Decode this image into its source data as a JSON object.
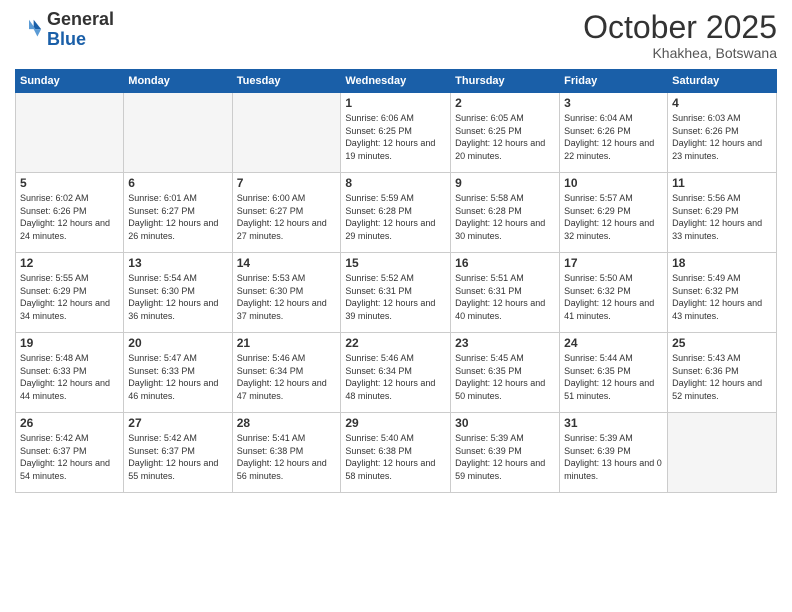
{
  "header": {
    "logo_general": "General",
    "logo_blue": "Blue",
    "month": "October 2025",
    "location": "Khakhea, Botswana"
  },
  "days_of_week": [
    "Sunday",
    "Monday",
    "Tuesday",
    "Wednesday",
    "Thursday",
    "Friday",
    "Saturday"
  ],
  "weeks": [
    [
      {
        "day": "",
        "empty": true
      },
      {
        "day": "",
        "empty": true
      },
      {
        "day": "",
        "empty": true
      },
      {
        "day": "1",
        "sunrise": "6:06 AM",
        "sunset": "6:25 PM",
        "daylight": "12 hours and 19 minutes."
      },
      {
        "day": "2",
        "sunrise": "6:05 AM",
        "sunset": "6:25 PM",
        "daylight": "12 hours and 20 minutes."
      },
      {
        "day": "3",
        "sunrise": "6:04 AM",
        "sunset": "6:26 PM",
        "daylight": "12 hours and 22 minutes."
      },
      {
        "day": "4",
        "sunrise": "6:03 AM",
        "sunset": "6:26 PM",
        "daylight": "12 hours and 23 minutes."
      }
    ],
    [
      {
        "day": "5",
        "sunrise": "6:02 AM",
        "sunset": "6:26 PM",
        "daylight": "12 hours and 24 minutes."
      },
      {
        "day": "6",
        "sunrise": "6:01 AM",
        "sunset": "6:27 PM",
        "daylight": "12 hours and 26 minutes."
      },
      {
        "day": "7",
        "sunrise": "6:00 AM",
        "sunset": "6:27 PM",
        "daylight": "12 hours and 27 minutes."
      },
      {
        "day": "8",
        "sunrise": "5:59 AM",
        "sunset": "6:28 PM",
        "daylight": "12 hours and 29 minutes."
      },
      {
        "day": "9",
        "sunrise": "5:58 AM",
        "sunset": "6:28 PM",
        "daylight": "12 hours and 30 minutes."
      },
      {
        "day": "10",
        "sunrise": "5:57 AM",
        "sunset": "6:29 PM",
        "daylight": "12 hours and 32 minutes."
      },
      {
        "day": "11",
        "sunrise": "5:56 AM",
        "sunset": "6:29 PM",
        "daylight": "12 hours and 33 minutes."
      }
    ],
    [
      {
        "day": "12",
        "sunrise": "5:55 AM",
        "sunset": "6:29 PM",
        "daylight": "12 hours and 34 minutes."
      },
      {
        "day": "13",
        "sunrise": "5:54 AM",
        "sunset": "6:30 PM",
        "daylight": "12 hours and 36 minutes."
      },
      {
        "day": "14",
        "sunrise": "5:53 AM",
        "sunset": "6:30 PM",
        "daylight": "12 hours and 37 minutes."
      },
      {
        "day": "15",
        "sunrise": "5:52 AM",
        "sunset": "6:31 PM",
        "daylight": "12 hours and 39 minutes."
      },
      {
        "day": "16",
        "sunrise": "5:51 AM",
        "sunset": "6:31 PM",
        "daylight": "12 hours and 40 minutes."
      },
      {
        "day": "17",
        "sunrise": "5:50 AM",
        "sunset": "6:32 PM",
        "daylight": "12 hours and 41 minutes."
      },
      {
        "day": "18",
        "sunrise": "5:49 AM",
        "sunset": "6:32 PM",
        "daylight": "12 hours and 43 minutes."
      }
    ],
    [
      {
        "day": "19",
        "sunrise": "5:48 AM",
        "sunset": "6:33 PM",
        "daylight": "12 hours and 44 minutes."
      },
      {
        "day": "20",
        "sunrise": "5:47 AM",
        "sunset": "6:33 PM",
        "daylight": "12 hours and 46 minutes."
      },
      {
        "day": "21",
        "sunrise": "5:46 AM",
        "sunset": "6:34 PM",
        "daylight": "12 hours and 47 minutes."
      },
      {
        "day": "22",
        "sunrise": "5:46 AM",
        "sunset": "6:34 PM",
        "daylight": "12 hours and 48 minutes."
      },
      {
        "day": "23",
        "sunrise": "5:45 AM",
        "sunset": "6:35 PM",
        "daylight": "12 hours and 50 minutes."
      },
      {
        "day": "24",
        "sunrise": "5:44 AM",
        "sunset": "6:35 PM",
        "daylight": "12 hours and 51 minutes."
      },
      {
        "day": "25",
        "sunrise": "5:43 AM",
        "sunset": "6:36 PM",
        "daylight": "12 hours and 52 minutes."
      }
    ],
    [
      {
        "day": "26",
        "sunrise": "5:42 AM",
        "sunset": "6:37 PM",
        "daylight": "12 hours and 54 minutes."
      },
      {
        "day": "27",
        "sunrise": "5:42 AM",
        "sunset": "6:37 PM",
        "daylight": "12 hours and 55 minutes."
      },
      {
        "day": "28",
        "sunrise": "5:41 AM",
        "sunset": "6:38 PM",
        "daylight": "12 hours and 56 minutes."
      },
      {
        "day": "29",
        "sunrise": "5:40 AM",
        "sunset": "6:38 PM",
        "daylight": "12 hours and 58 minutes."
      },
      {
        "day": "30",
        "sunrise": "5:39 AM",
        "sunset": "6:39 PM",
        "daylight": "12 hours and 59 minutes."
      },
      {
        "day": "31",
        "sunrise": "5:39 AM",
        "sunset": "6:39 PM",
        "daylight": "13 hours and 0 minutes."
      },
      {
        "day": "",
        "empty": true
      }
    ]
  ]
}
